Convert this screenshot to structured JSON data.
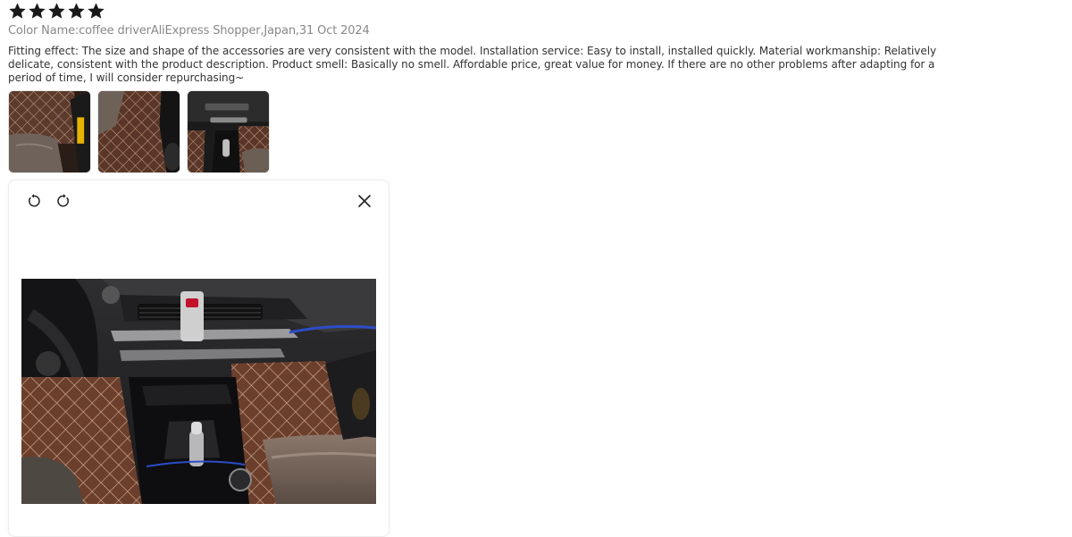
{
  "review": {
    "rating": 5,
    "rating_max": 5,
    "star_color": "#191919",
    "meta": "Color Name:coffee driverAliExpress Shopper,Japan,31 Oct 2024",
    "text": "Fitting effect: The size and shape of the accessories are very consistent with the model. Installation service: Easy to install, installed quickly. Material workmanship: Relatively delicate, consistent with the product description. Product smell: Basically no smell. Affordable price, great value for money. If there are no other problems after adapting for a period of time, I will consider repurchasing~"
  },
  "thumbnails": [
    {
      "icon": "photo-floor-mat-driver"
    },
    {
      "icon": "photo-floor-mat-passenger"
    },
    {
      "icon": "photo-center-console"
    }
  ],
  "viewer": {
    "rotate_left_icon": "rotate-left-icon",
    "rotate_right_icon": "rotate-right-icon",
    "close_icon": "close-icon",
    "image_icon": "photo-car-interior-mats"
  }
}
